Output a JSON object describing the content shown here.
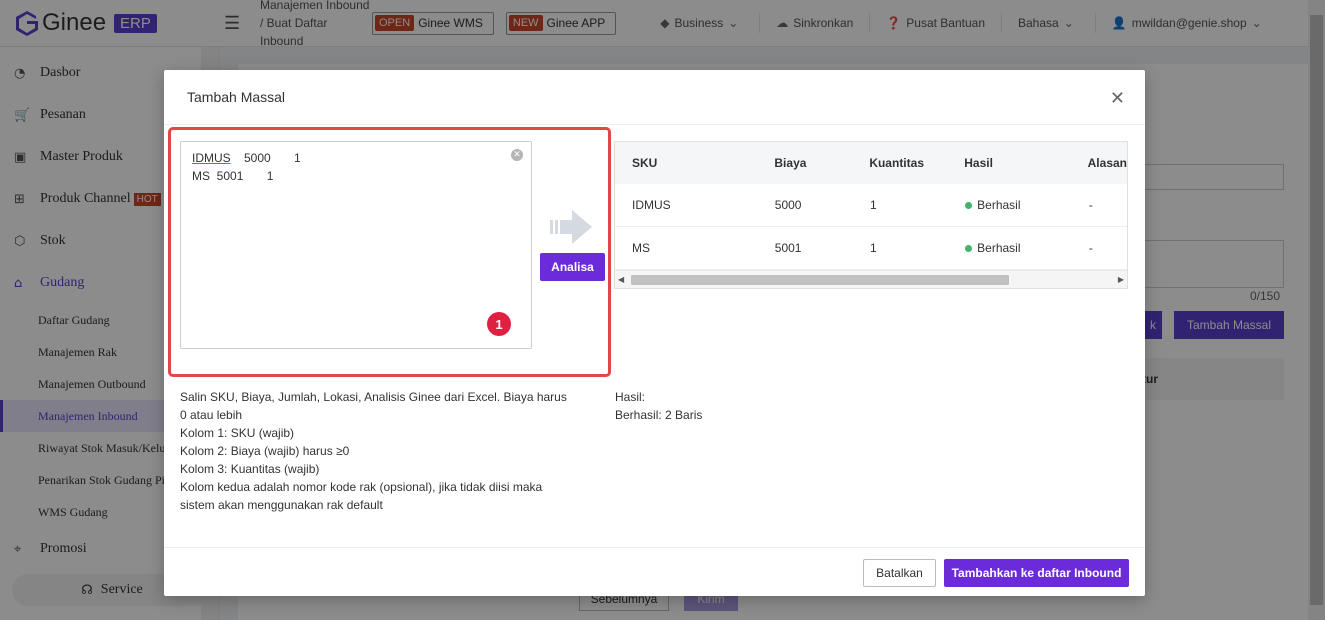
{
  "header": {
    "logo_text": "Ginee",
    "logo_badge": "ERP",
    "breadcrumb": "Manajemen Inbound / Buat Daftar Inbound",
    "badges": [
      {
        "tag": "OPEN",
        "label": "Ginee WMS"
      },
      {
        "tag": "NEW",
        "label": "Ginee APP"
      }
    ],
    "nav": {
      "business": "Business",
      "sync": "Sinkronkan",
      "help": "Pusat Bantuan",
      "language": "Bahasa",
      "user": "mwildan@genie.shop"
    }
  },
  "sidebar": {
    "items": [
      {
        "label": "Dasbor"
      },
      {
        "label": "Pesanan"
      },
      {
        "label": "Master Produk"
      },
      {
        "label": "Produk Channel",
        "badge": "HOT"
      },
      {
        "label": "Stok"
      },
      {
        "label": "Gudang"
      }
    ],
    "sub_items": [
      {
        "label": "Daftar Gudang"
      },
      {
        "label": "Manajemen Rak"
      },
      {
        "label": "Manajemen Outbound"
      },
      {
        "label": "Manajemen Inbound"
      },
      {
        "label": "Riwayat Stok Masuk/Keluar"
      },
      {
        "label": "Penarikan Stok Gudang Pihak Ketiga"
      },
      {
        "label": "WMS Gudang"
      }
    ],
    "promo": "Promosi",
    "service": "Service"
  },
  "background": {
    "count": "0/150",
    "btn_tambah_massal": "Tambah Massal",
    "btn_partial": "k",
    "table_header_partial": "tur",
    "btn_prev": "Sebelumnya",
    "btn_submit": "Kirim"
  },
  "modal": {
    "title": "Tambah Massal",
    "input_lines": [
      {
        "sku": "IDMUS",
        "rest": "    5000       1"
      },
      {
        "sku": "MS",
        "rest": "  5001       1"
      }
    ],
    "step": "1",
    "analyze_button": "Analisa",
    "table": {
      "columns": [
        "SKU",
        "Biaya",
        "Kuantitas",
        "Hasil",
        "Alasan"
      ],
      "rows": [
        {
          "sku": "IDMUS",
          "cost": "5000",
          "qty": "1",
          "result": "Berhasil",
          "reason": "-"
        },
        {
          "sku": "MS",
          "cost": "5001",
          "qty": "1",
          "result": "Berhasil",
          "reason": "-"
        }
      ]
    },
    "help_lines": [
      "Salin SKU, Biaya, Jumlah, Lokasi, Analisis Ginee dari Excel. Biaya harus 0 atau lebih",
      "Kolom 1: SKU (wajib)",
      "Kolom 2: Biaya (wajib) harus ≥0",
      "Kolom 3: Kuantitas (wajib)",
      "Kolom kedua adalah nomor kode rak (opsional), jika tidak diisi maka sistem akan menggunakan rak default"
    ],
    "result_label": "Hasil:",
    "result_value": "Berhasil: 2 Baris",
    "cancel_button": "Batalkan",
    "submit_button": "Tambahkan ke daftar Inbound"
  },
  "colors": {
    "primary": "#6c2bd9",
    "highlight": "#e04848",
    "success": "#3fb46a"
  }
}
